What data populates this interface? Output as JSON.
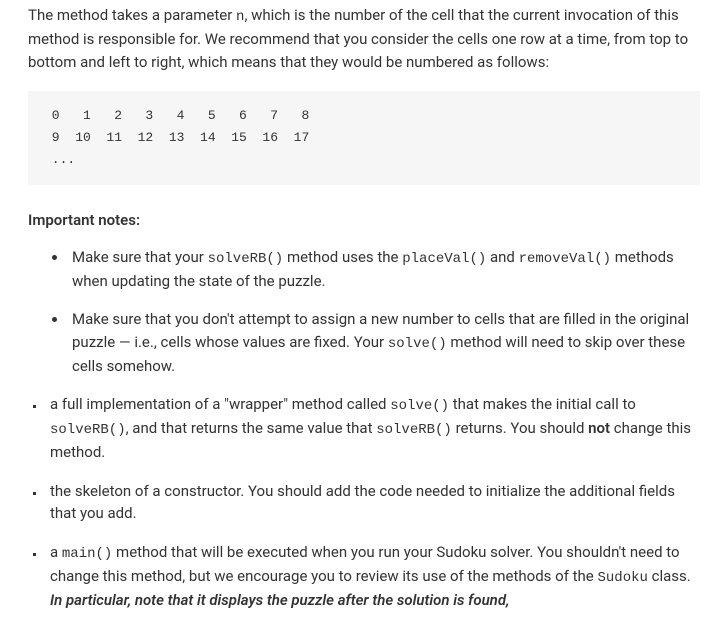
{
  "intro": {
    "pre_n": "The method takes a parameter ",
    "n": "n",
    "post_n": ", which is the number of the cell that the current invocation of this method is responsible for. We recommend that you consider the cells one row at a time, from top to bottom and left to right, which means that they would be numbered as follows:"
  },
  "code_block": " 0   1   2   3   4   5   6   7   8\n 9  10  11  12  13  14  15  16  17\n ...",
  "notes_heading": "Important notes:",
  "note1": {
    "t1": "Make sure that your ",
    "c1": "solveRB()",
    "t2": " method uses the ",
    "c2": "placeVal()",
    "t3": " and ",
    "c3": "removeVal()",
    "t4": " methods when updating the state of the puzzle."
  },
  "note2": {
    "t1": "Make sure that you don't attempt to assign a new number to cells that are filled in the original puzzle — i.e., cells whose values are fixed. Your ",
    "c1": "solve()",
    "t2": " method will need to skip over these cells somehow."
  },
  "sq1": {
    "t1": "a full implementation of a \"wrapper\" method called ",
    "c1": "solve()",
    "t2": " that makes the initial call to ",
    "c2": "solveRB()",
    "t3": ", and that returns the same value that ",
    "c3": "solveRB()",
    "t4": " returns. You should ",
    "b1": "not",
    "t5": " change this method."
  },
  "sq2": {
    "t1": "the skeleton of a constructor. You should add the code needed to initialize the additional fields that you add."
  },
  "sq3": {
    "t1": "a ",
    "c1": "main()",
    "t2": " method that will be executed when you run your Sudoku solver. You shouldn't need to change this method, but we encourage you to review its use of the methods of the ",
    "c2": "Sudoku",
    "t3": " class. ",
    "ib1": "In particular, note that it displays the puzzle after the solution is found,"
  }
}
